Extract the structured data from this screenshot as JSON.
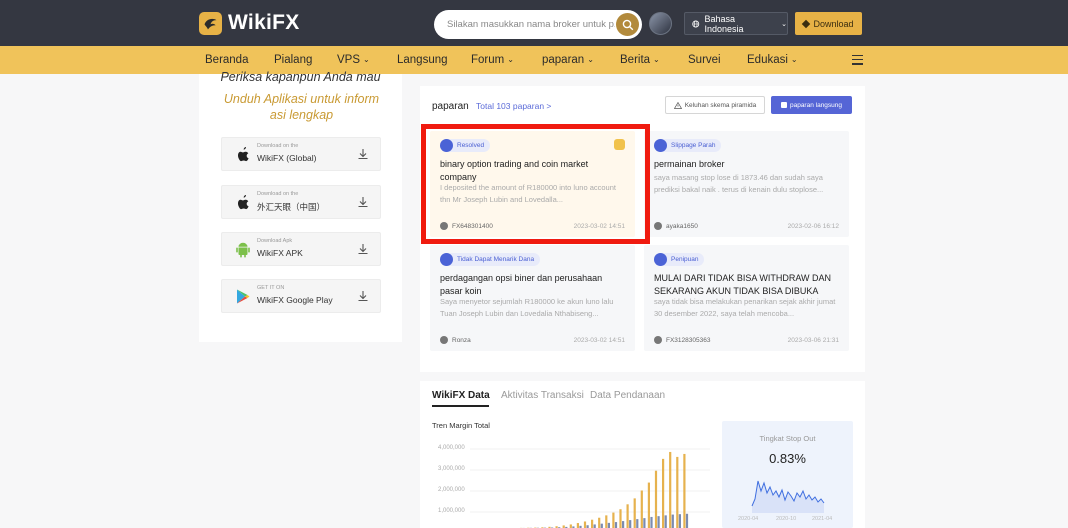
{
  "header": {
    "logo_text": "WikiFX",
    "search_placeholder": "Silakan masukkan nama broker untuk p...",
    "language": "Bahasa Indonesia",
    "download_label": "Download"
  },
  "nav": {
    "items": [
      {
        "label": "Beranda"
      },
      {
        "label": "Pialang"
      },
      {
        "label": "VPS"
      },
      {
        "label": "Langsung"
      },
      {
        "label": "Forum"
      },
      {
        "label": "paparan"
      },
      {
        "label": "Berita"
      },
      {
        "label": "Survei"
      },
      {
        "label": "Edukasi"
      }
    ]
  },
  "sidebar": {
    "promo_line1": "Periksa kapanpun Anda mau",
    "promo_line2": "Unduh Aplikasi untuk inform asi lengkap",
    "apps": [
      {
        "small": "Download on the",
        "name": "WikiFX (Global)",
        "icon": "apple-icon"
      },
      {
        "small": "Download on the",
        "name": "外汇天眼（中国）",
        "icon": "apple-icon"
      },
      {
        "small": "Download Apk",
        "name": "WikiFX APK",
        "icon": "android-icon"
      },
      {
        "small": "GET IT ON",
        "name": "WikiFX Google Play",
        "icon": "google-play-icon"
      }
    ]
  },
  "exposure": {
    "title": "paparan",
    "total": "Total 103 paparan >",
    "complaint_button": "Keluhan skema piramida",
    "live_button": "paparan langsung",
    "cards": [
      {
        "badge": "Resolved",
        "title": "binary option trading and coin market company",
        "desc": "I deposited the amount of R180000 into luno account thn Mr Joseph Lubin and Lovedalla...",
        "user": "FX648301400",
        "time": "2023-03-02 14:51"
      },
      {
        "badge": "Slippage Parah",
        "title": "permainan broker",
        "desc": "saya masang stop lose di 1873.46 dan sudah saya prediksi bakal naik . terus di kenain dulu stoplose...",
        "user": "ayaka1650",
        "time": "2023-02-06 16:12"
      },
      {
        "badge": "Tidak Dapat Menarik Dana",
        "title": "perdagangan opsi biner dan perusahaan pasar koin",
        "desc": "Saya menyetor sejumlah R180000 ke akun luno lalu Tuan Joseph Lubin dan Lovedalia Nthabiseng...",
        "user": "Ronza",
        "time": "2023-03-02 14:51"
      },
      {
        "badge": "Penipuan",
        "title": "MULAI DARI TIDAK BISA WITHDRAW DAN SEKARANG AKUN TIDAK BISA DIBUKA",
        "desc": "saya tidak bisa melakukan penarikan sejak akhir jumat 30 desember 2022, saya telah mencoba...",
        "user": "FX3128305363",
        "time": "2023-03-06 21:31"
      }
    ]
  },
  "data_section": {
    "tabs": [
      {
        "label": "WikiFX Data"
      },
      {
        "label": "Aktivitas Transaksi"
      },
      {
        "label": "Data Pendanaan"
      }
    ],
    "margin_title": "Tren Margin Total",
    "stop_out_label": "Tingkat Stop Out",
    "stop_out_value": "0.83%",
    "stop_out_x_ticks": [
      "2020-04",
      "2020-10",
      "2021-04"
    ]
  },
  "chart_data": {
    "type": "bar",
    "yticks": [
      "4,000,000",
      "3,000,000",
      "2,000,000",
      "1,000,000"
    ],
    "ylim": [
      0,
      4000000
    ],
    "series": [
      {
        "values": [
          5000,
          12000,
          20000,
          35000,
          60000,
          90000,
          130000,
          180000,
          250000,
          330000,
          420000,
          520000,
          640000,
          780000,
          950000,
          1200000,
          1500000,
          1900000,
          2300000,
          2900000,
          3500000,
          3850000,
          3600000,
          3750000
        ],
        "color": "#e6b24e"
      },
      {
        "values": [
          3000,
          8000,
          12000,
          18000,
          25000,
          40000,
          55000,
          80000,
          110000,
          140000,
          180000,
          220000,
          260000,
          300000,
          350000,
          400000,
          450000,
          500000,
          560000,
          600000,
          640000,
          680000,
          700000,
          720000
        ],
        "color": "#7b8bb0"
      }
    ]
  }
}
